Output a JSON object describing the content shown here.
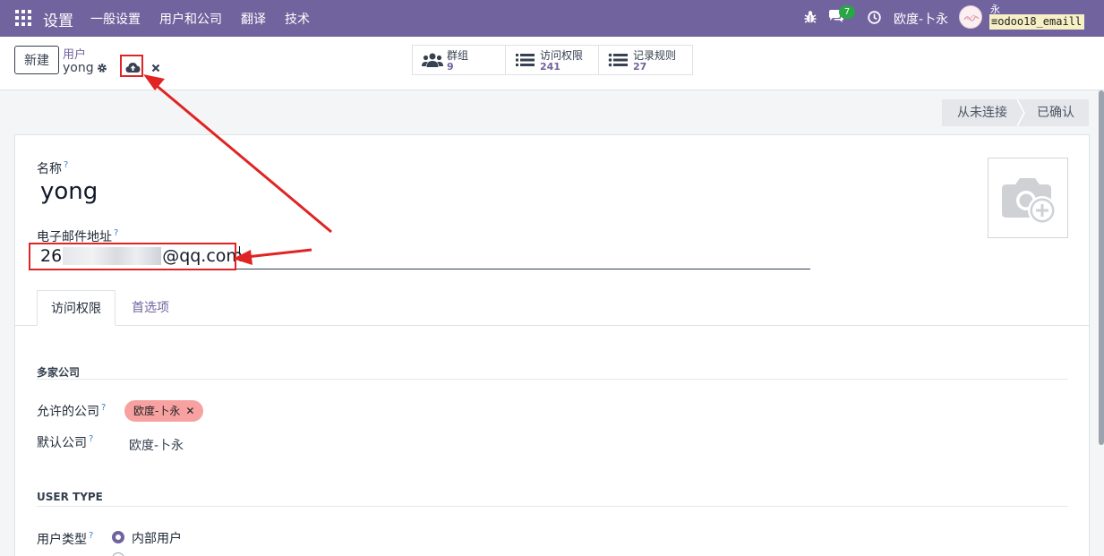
{
  "navbar": {
    "brand": "设置",
    "menu": [
      "一般设置",
      "用户和公司",
      "翻译",
      "技术"
    ],
    "chat_count": "7",
    "company": "欧度-卜永",
    "user_char": "永",
    "db_name": "odoo18_emaill"
  },
  "control_panel": {
    "new_label": "新建",
    "breadcrumb_parent": "用户",
    "breadcrumb_current": "yong"
  },
  "smart_buttons": [
    {
      "label": "群组",
      "value": "9",
      "icon": "users-icon"
    },
    {
      "label": "访问权限",
      "value": "241",
      "icon": "list-icon"
    },
    {
      "label": "记录规则",
      "value": "27",
      "icon": "list-icon"
    }
  ],
  "status": {
    "steps": [
      "从未连接",
      "已确认"
    ]
  },
  "form": {
    "name_label": "名称",
    "name_value": "yong",
    "email_label": "电子邮件地址",
    "email_prefix": "26",
    "email_suffix": "@qq.com",
    "help_mark": "?",
    "tabs": [
      "访问权限",
      "首选项"
    ],
    "section_companies": "多家公司",
    "allowed_label": "允许的公司",
    "allowed_tag": "欧度-卜永",
    "default_label": "默认公司",
    "default_value": "欧度-卜永",
    "section_user_type": "USER TYPE",
    "user_type_label": "用户类型",
    "user_type_value": "内部用户"
  },
  "colors": {
    "brand": "#71639e",
    "highlight": "#e02424",
    "tag": "#f7a1a1",
    "badge": "#28a745"
  }
}
